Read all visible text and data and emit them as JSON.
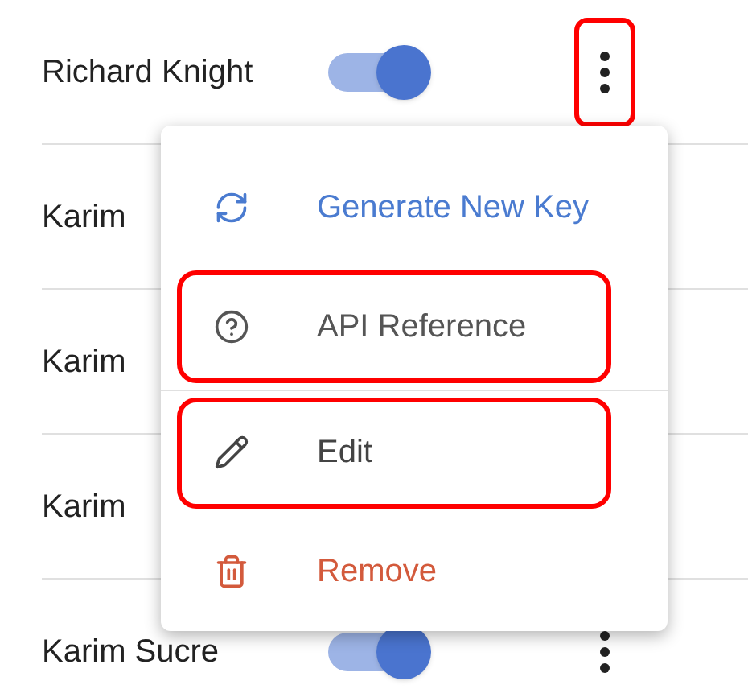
{
  "rows": [
    {
      "name": "Richard Knight",
      "on": true,
      "menu_highlighted": true
    },
    {
      "name": "Karim"
    },
    {
      "name": "Karim"
    },
    {
      "name": "Karim"
    },
    {
      "name": "Karim Sucre",
      "on": true,
      "menu_highlighted": false
    }
  ],
  "menu": {
    "items": [
      {
        "kind": "refresh",
        "label": "Generate New Key",
        "highlighted": false
      },
      {
        "kind": "help",
        "label": "API Reference",
        "highlighted": true
      },
      {
        "kind": "edit",
        "label": "Edit",
        "highlighted": true
      },
      {
        "kind": "delete",
        "label": "Remove",
        "highlighted": false
      }
    ]
  }
}
